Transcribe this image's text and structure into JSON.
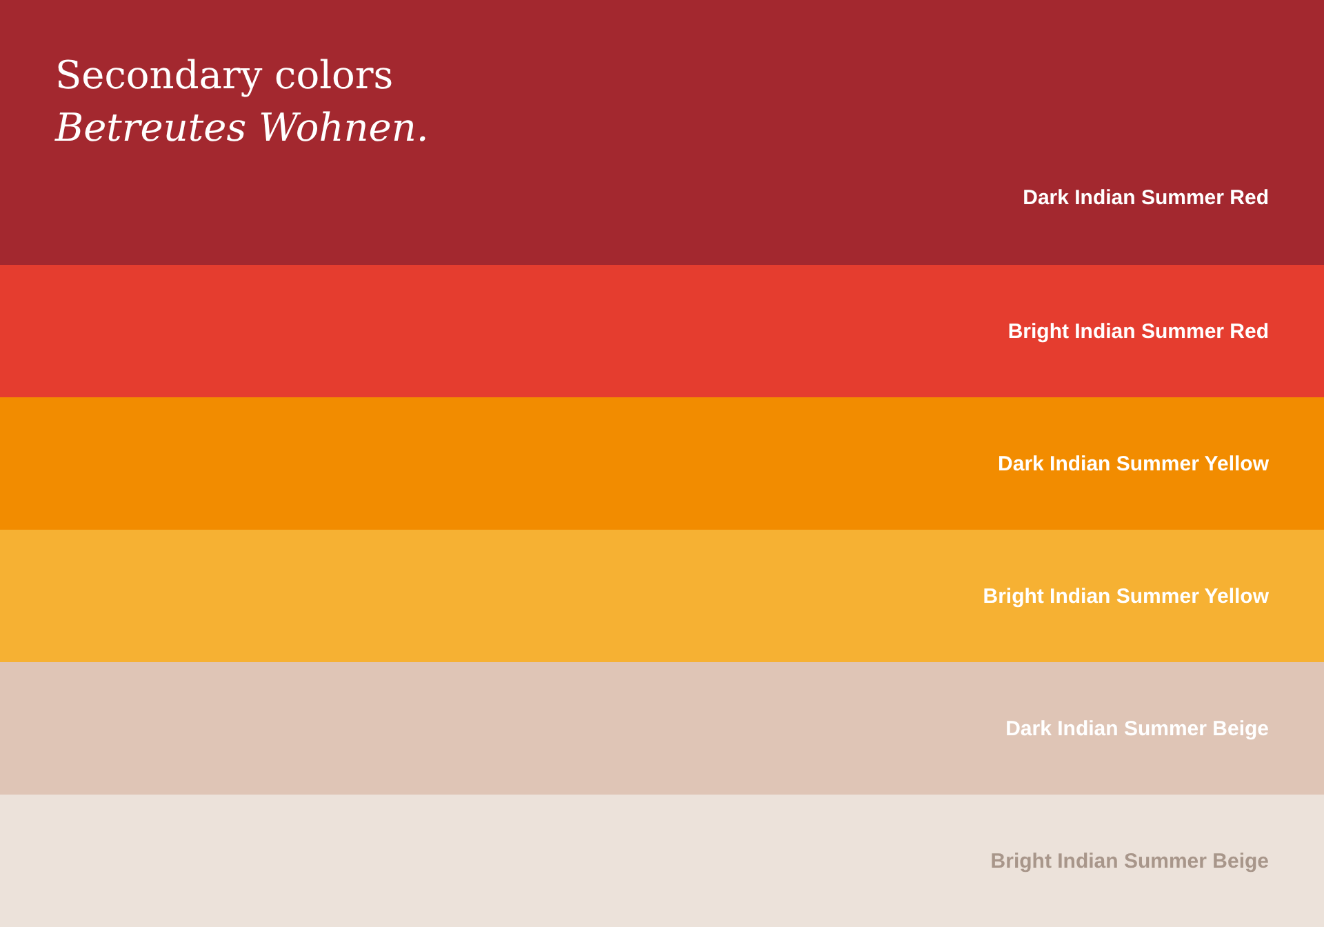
{
  "heading": {
    "title": "Secondary colors",
    "subtitle": "Betreutes Wohnen."
  },
  "swatches": [
    {
      "name": "Dark Indian Summer Red",
      "color": "#a3282f"
    },
    {
      "name": "Bright Indian Summer Red",
      "color": "#e53d2f"
    },
    {
      "name": "Dark Indian Summer Yellow",
      "color": "#f28c00"
    },
    {
      "name": "Bright Indian Summer Yellow",
      "color": "#f6b133"
    },
    {
      "name": "Dark Indian Summer Beige",
      "color": "#dfc5b6"
    },
    {
      "name": "Bright Indian Summer Beige",
      "color": "#ece2da"
    }
  ]
}
